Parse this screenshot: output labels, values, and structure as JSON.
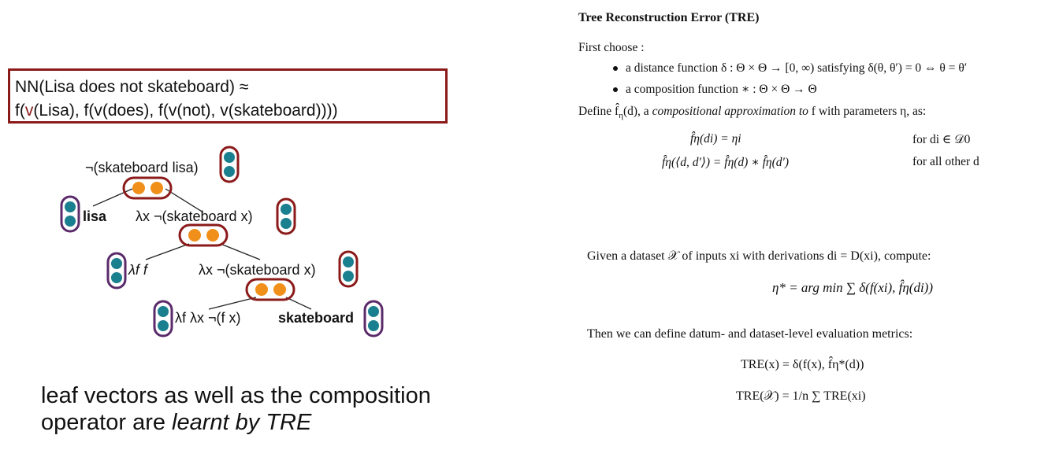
{
  "left": {
    "box_line1": "NN(Lisa does not skateboard) ≈",
    "box_line2_parts": [
      "f(",
      "v",
      "(Lisa), f(v(does), f(v(not), v(skateboard))))"
    ],
    "tree": {
      "root_label": "¬(skateboard lisa)",
      "lisa_label": "lisa",
      "node2_label": "λx ¬(skateboard x)",
      "ff_label": "λf f",
      "node3_label": "λx ¬(skateboard x)",
      "leaf_label": "λf λx ¬(f x)",
      "skate_label": "skateboard"
    },
    "bottom_line1": "leaf vectors as well as the composition",
    "bottom_line2_plain": "operator are ",
    "bottom_line2_italic": "learnt by TRE"
  },
  "right": {
    "heading_main": "Tree Reconstruction Error (",
    "heading_sc": "TRE",
    "heading_close": ")",
    "first_choose": "First choose :",
    "bullet1": "a distance function δ : Θ × Θ → [0, ∞) satisfying δ(θ, θ′) = 0 ⇔ θ = θ′",
    "bullet2": "a composition function ∗ : Θ × Θ → Θ",
    "define_plain": "Define f̂",
    "define_rest": "(d), a ",
    "define_italic": "compositional approximation to",
    "define_end": " f with parameters η, as:",
    "eq1_lhs": "f̂η(di) = ηi",
    "eq1_cond": "for di ∈ 𝒟0",
    "eq2_lhs": "f̂η(⟨d, d′⟩) = f̂η(d) ∗ f̂η(d′)",
    "eq2_cond": "for all other d",
    "given": "Given a dataset 𝒳 of inputs xi with derivations di = D(xi), compute:",
    "argmin": "η* = arg min ∑ δ(f(xi), f̂η(di))",
    "then": "Then we can define datum- and dataset-level evaluation metrics:",
    "tre1": "TRE(x) = δ(f(x), f̂η*(d))",
    "tre2": "TRE(𝒳) = 1/n ∑ TRE(xi)"
  },
  "colors": {
    "box_border": "#8b1a1a",
    "teal_dot": "#1a7f8e",
    "orange_dot": "#f0901a",
    "red_outline": "#8b1a1a",
    "purple_outline": "#5a2a6a"
  }
}
